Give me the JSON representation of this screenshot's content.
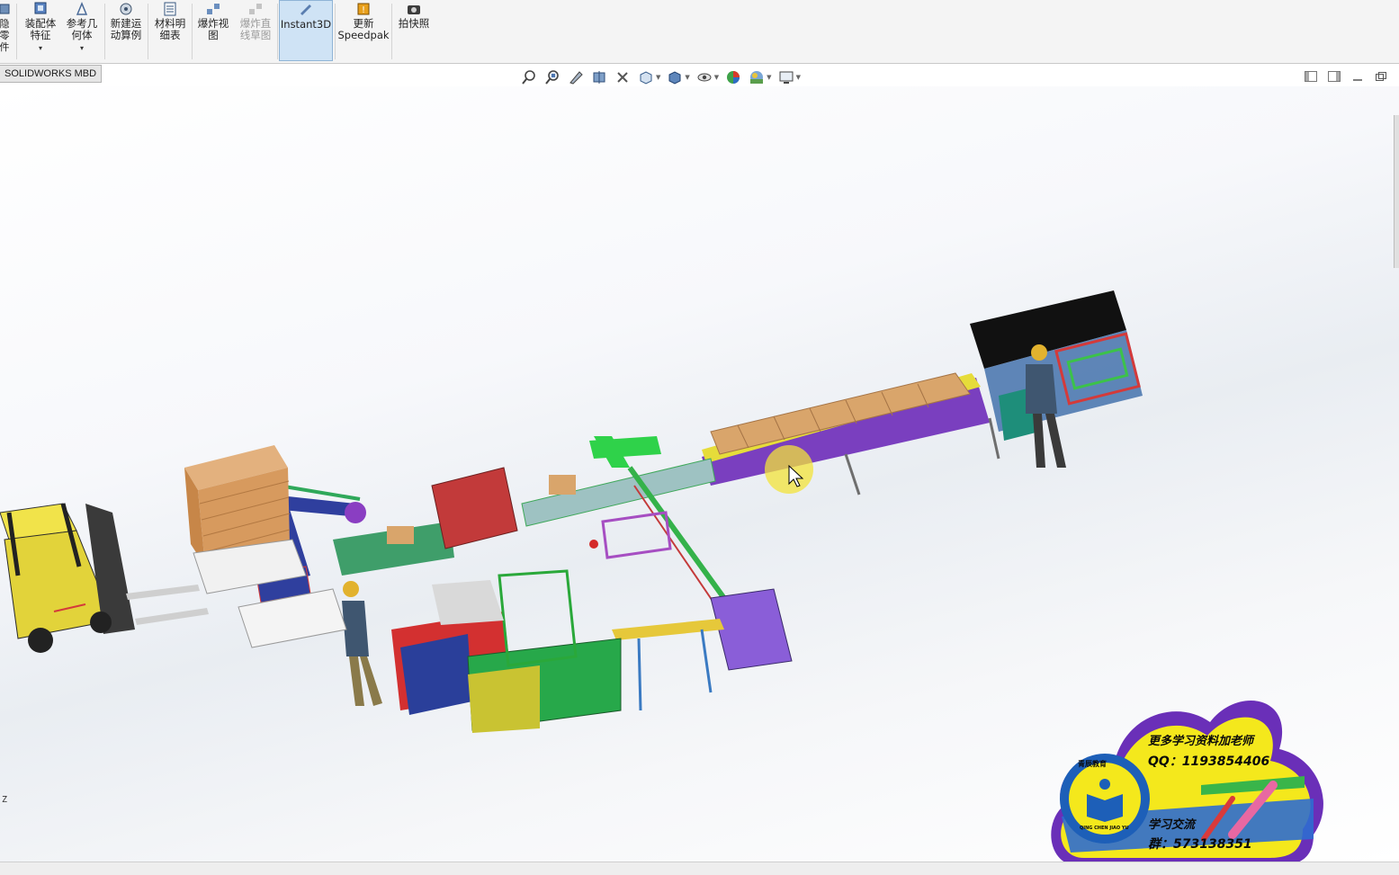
{
  "ribbon": {
    "items": [
      {
        "label": "隐\n零\n件",
        "icon": "hide-components-icon"
      },
      {
        "label": "装配体\n特征",
        "icon": "assembly-features-icon"
      },
      {
        "label": "参考几\n何体",
        "icon": "reference-geometry-icon"
      },
      {
        "label": "新建运\n动算例",
        "icon": "new-motion-study-icon"
      },
      {
        "label": "材料明\n细表",
        "icon": "bill-of-materials-icon"
      },
      {
        "label": "爆炸视\n图",
        "icon": "exploded-view-icon"
      },
      {
        "label": "爆炸直\n线草图",
        "icon": "explode-line-sketch-icon"
      },
      {
        "label": "Instant3D",
        "icon": "instant3d-icon"
      },
      {
        "label": "更新\nSpeedpak",
        "icon": "update-speedpak-icon"
      },
      {
        "label": "拍快照",
        "icon": "take-snapshot-icon"
      }
    ]
  },
  "tab": {
    "label": "SOLIDWORKS MBD"
  },
  "hud": {
    "icons": [
      "zoom-to-fit-icon",
      "zoom-to-area-icon",
      "previous-view-icon",
      "section-view-icon",
      "dynamic-annotation-icon",
      "view-orientation-icon",
      "display-style-icon",
      "hide-show-items-icon",
      "edit-appearance-icon",
      "apply-scene-icon",
      "view-settings-icon"
    ]
  },
  "viewport": {
    "triad_label": "Z"
  },
  "watermark": {
    "line1": "更多学习资料加老师",
    "qq": "QQ：1193854406",
    "exchange": "学习交流",
    "group": "群：573138351",
    "seal_text": "青辰教育",
    "seal_pinyin": "QING CHEN JIAO YU",
    "colors": {
      "outer": "#6a2fb8",
      "inner": "#f4e81c",
      "seal": "#1d5fb8"
    }
  }
}
